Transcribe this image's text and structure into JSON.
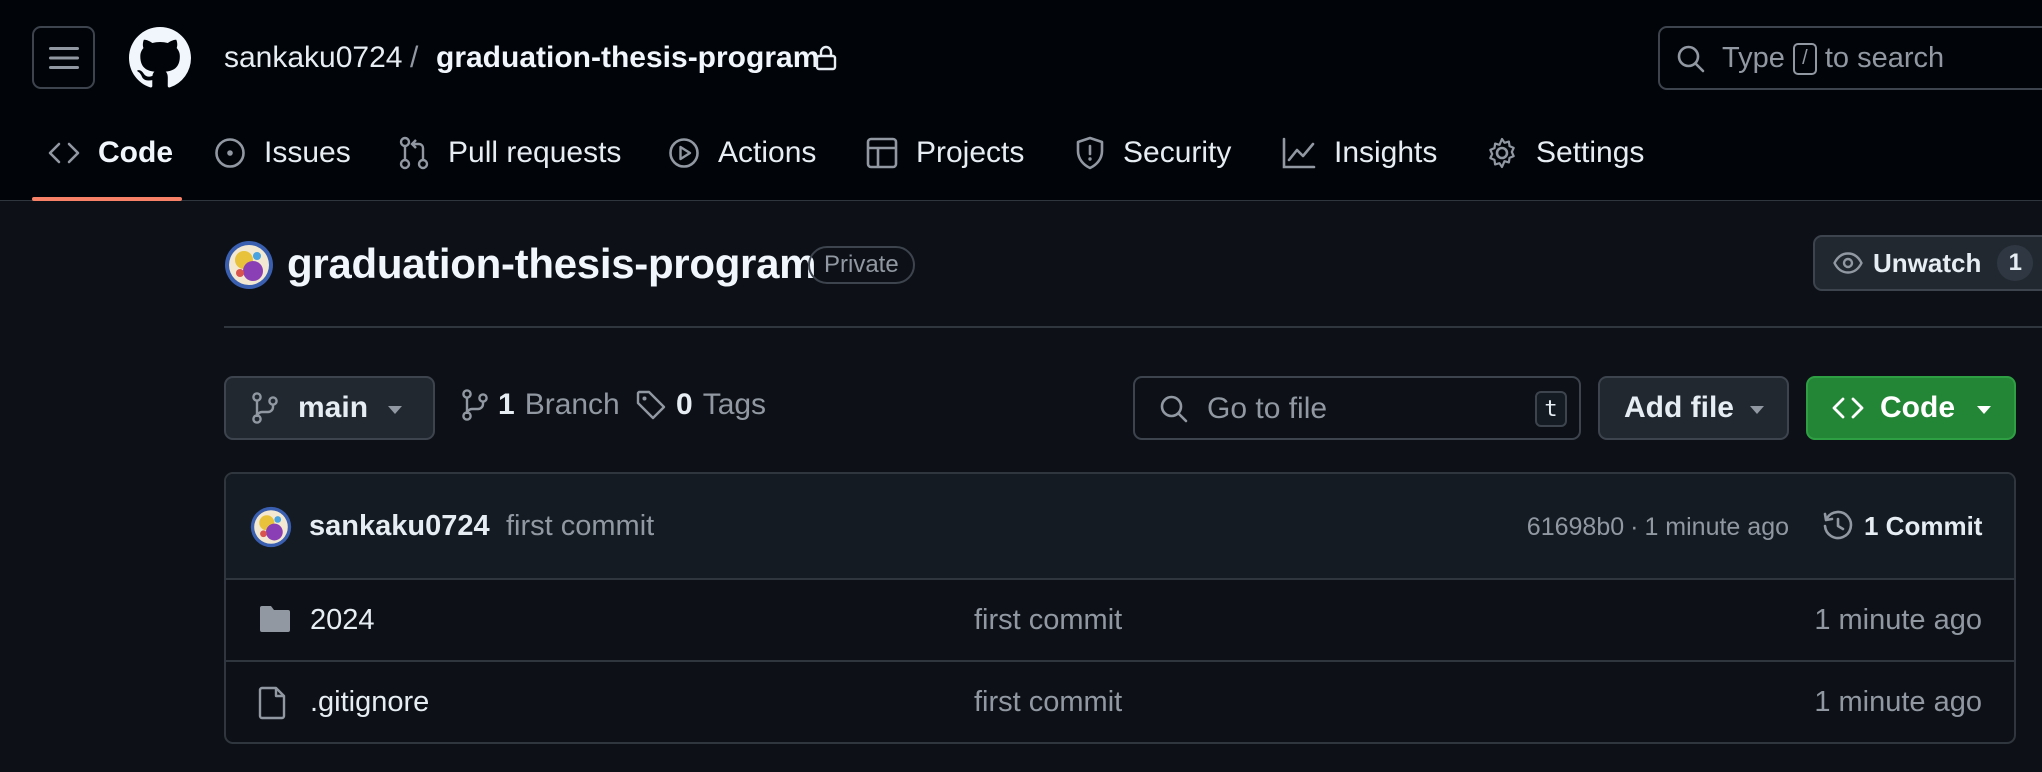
{
  "header": {
    "owner": "sankaku0724",
    "separator": "/",
    "repo_name": "graduation-thesis-program",
    "search": {
      "prefix": "Type",
      "key": "/",
      "suffix": "to search"
    }
  },
  "tabs": [
    {
      "label": "Code",
      "icon": "code-icon",
      "active": true
    },
    {
      "label": "Issues",
      "icon": "issue-opened-icon"
    },
    {
      "label": "Pull requests",
      "icon": "pull-request-icon"
    },
    {
      "label": "Actions",
      "icon": "play-icon"
    },
    {
      "label": "Projects",
      "icon": "table-icon"
    },
    {
      "label": "Security",
      "icon": "shield-icon"
    },
    {
      "label": "Insights",
      "icon": "graph-icon"
    },
    {
      "label": "Settings",
      "icon": "gear-icon"
    }
  ],
  "repo": {
    "title": "graduation-thesis-program",
    "visibility": "Private",
    "unwatch_label": "Unwatch",
    "watch_count": "1"
  },
  "toolbar": {
    "branch": "main",
    "branch_count": "1",
    "branch_label": "Branch",
    "tag_count": "0",
    "tag_label": "Tags",
    "goto_placeholder": "Go to file",
    "goto_key": "t",
    "add_file_label": "Add file",
    "code_label": "Code"
  },
  "commit": {
    "author": "sankaku0724",
    "message": "first commit",
    "hash": "61698b0",
    "dot": "·",
    "time": "1 minute ago",
    "commits_label": "1 Commit"
  },
  "files": [
    {
      "name": "2024",
      "type": "folder",
      "commit": "first commit",
      "time": "1 minute ago"
    },
    {
      "name": ".gitignore",
      "type": "file",
      "commit": "first commit",
      "time": "1 minute ago"
    }
  ],
  "colors": {
    "accent_underline": "#f78166",
    "primary_button": "#238636",
    "background": "#0d1117",
    "header_background": "#010409"
  }
}
